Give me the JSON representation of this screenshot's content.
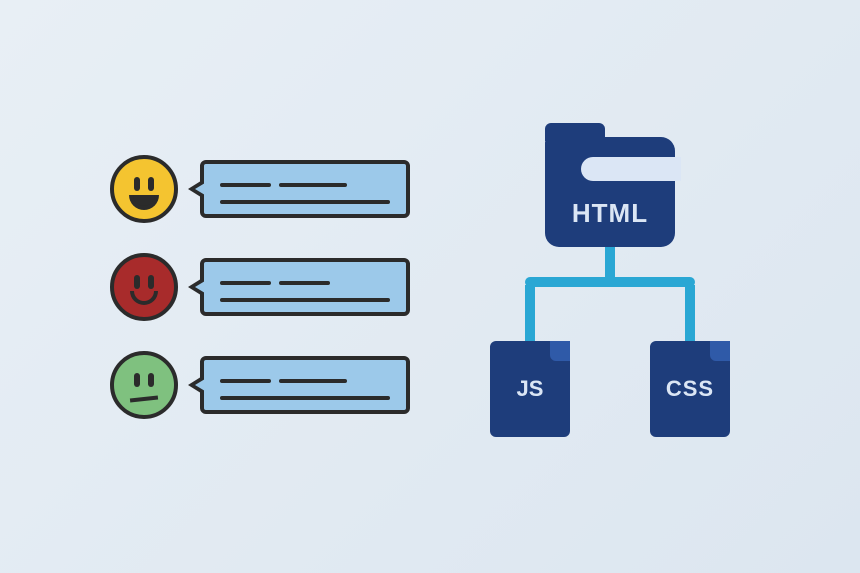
{
  "feedback": {
    "items": [
      {
        "mood": "happy",
        "color": "yellow"
      },
      {
        "mood": "smile",
        "color": "red"
      },
      {
        "mood": "neutral",
        "color": "green"
      }
    ]
  },
  "tech_tree": {
    "root": "HTML",
    "left": "JS",
    "right": "CSS"
  },
  "palette": {
    "bubble": "#9cc9ea",
    "outline": "#2b2b2b",
    "folder": "#1e3d7b",
    "connector": "#2aa7d4",
    "face_yellow": "#f4c430",
    "face_red": "#a82b2b",
    "face_green": "#7fc17f"
  }
}
